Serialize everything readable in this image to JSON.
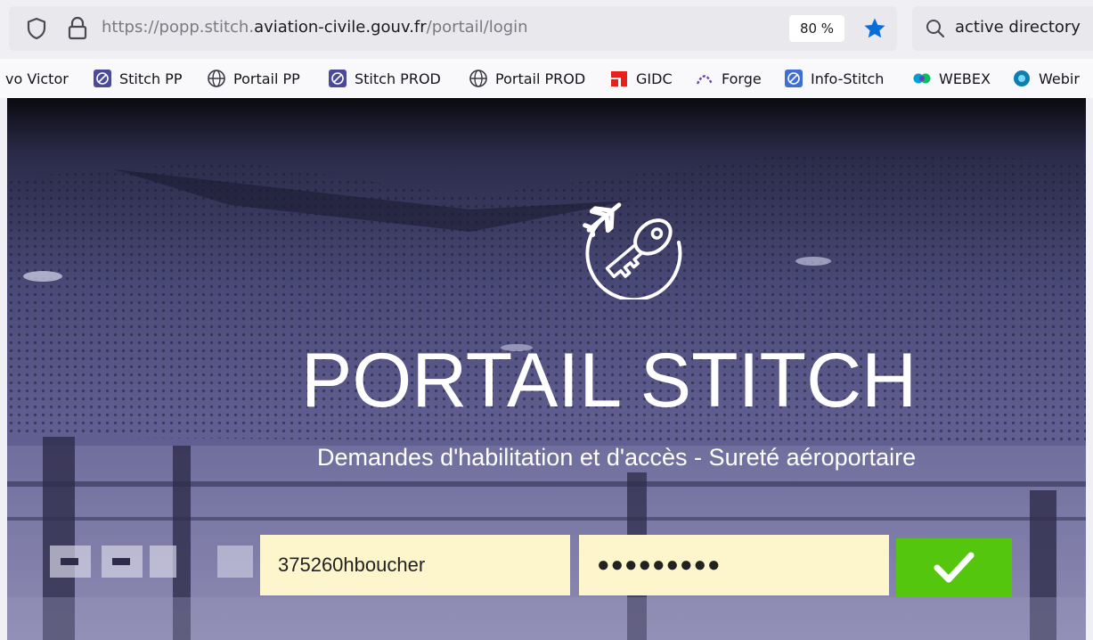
{
  "browser": {
    "url_prefix": "https://popp.stitch.",
    "url_domain": "aviation-civile.gouv.fr",
    "url_path": "/portail/login",
    "zoom": "80 %",
    "search_text": "active directory",
    "bookmarks": [
      {
        "label": "vo Victor",
        "icon": "none"
      },
      {
        "label": "Stitch PP",
        "icon": "stitch-icon"
      },
      {
        "label": "Portail PP",
        "icon": "globe-icon"
      },
      {
        "label": "Stitch PROD",
        "icon": "stitch-icon"
      },
      {
        "label": "Portail PROD",
        "icon": "globe-icon"
      },
      {
        "label": "GIDC",
        "icon": "gidc-icon"
      },
      {
        "label": "Forge",
        "icon": "forge-icon"
      },
      {
        "label": "Info-Stitch",
        "icon": "stitch-icon"
      },
      {
        "label": "WEBEX",
        "icon": "webex-icon"
      },
      {
        "label": "Webir",
        "icon": "webinar-icon"
      }
    ]
  },
  "portal": {
    "title": "PORTAIL STITCH",
    "subtitle": "Demandes d'habilitation et d'accès - Sureté aéroportaire",
    "username_value": "375260hboucher",
    "password_value": "●●●●●●●●●",
    "logo_icon": "plane-key-icon",
    "submit_icon": "checkmark-icon"
  },
  "colors": {
    "submit_green": "#55c60e",
    "input_background": "#fdf6cc",
    "bookmark_star": "#0a6cd8"
  }
}
